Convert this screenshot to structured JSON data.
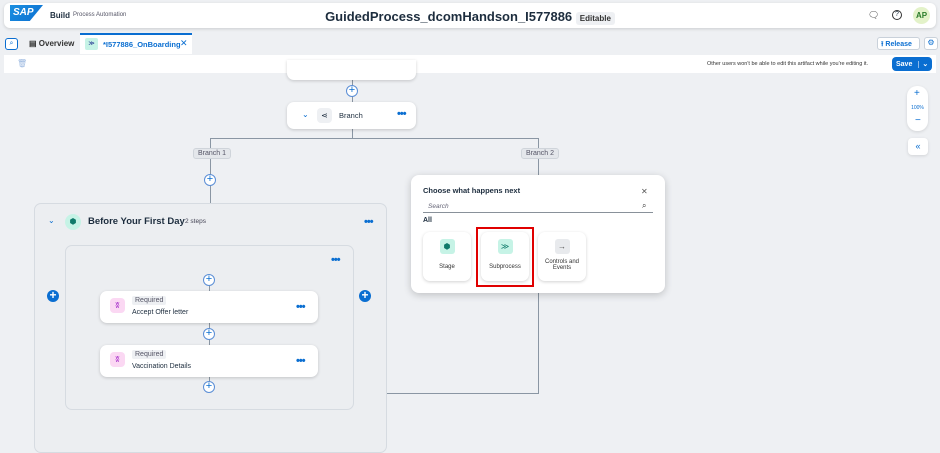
{
  "header": {
    "brand": "SAP",
    "product": "Build",
    "subproduct": "Process Automation",
    "title": "GuidedProcess_dcomHandson_I577886",
    "status_badge": "Editable",
    "avatar": "AP"
  },
  "tabs": [
    {
      "label": "Overview"
    },
    {
      "label": "*I577886_OnBoarding"
    }
  ],
  "toolbar": {
    "release": "Release",
    "notice": "Other users won't be able to edit this artifact while you're editing it.",
    "save": "Save"
  },
  "zoom": {
    "level": "100%"
  },
  "canvas": {
    "branch_node": "Branch",
    "branch1": "Branch 1",
    "branch2": "Branch 2",
    "stage": {
      "title": "Before Your First Day",
      "steps": "2 steps",
      "items": [
        {
          "tag": "Required",
          "label": "Accept Offer letter"
        },
        {
          "tag": "Required",
          "label": "Vaccination Details"
        }
      ]
    }
  },
  "popup": {
    "title": "Choose what happens next",
    "search_placeholder": "Search",
    "section": "All",
    "options": [
      {
        "label": "Stage"
      },
      {
        "label": "Subprocess"
      },
      {
        "label": "Controls and Events"
      }
    ]
  },
  "colors": {
    "accent": "#0a6ed1",
    "highlight": "#e00000"
  }
}
